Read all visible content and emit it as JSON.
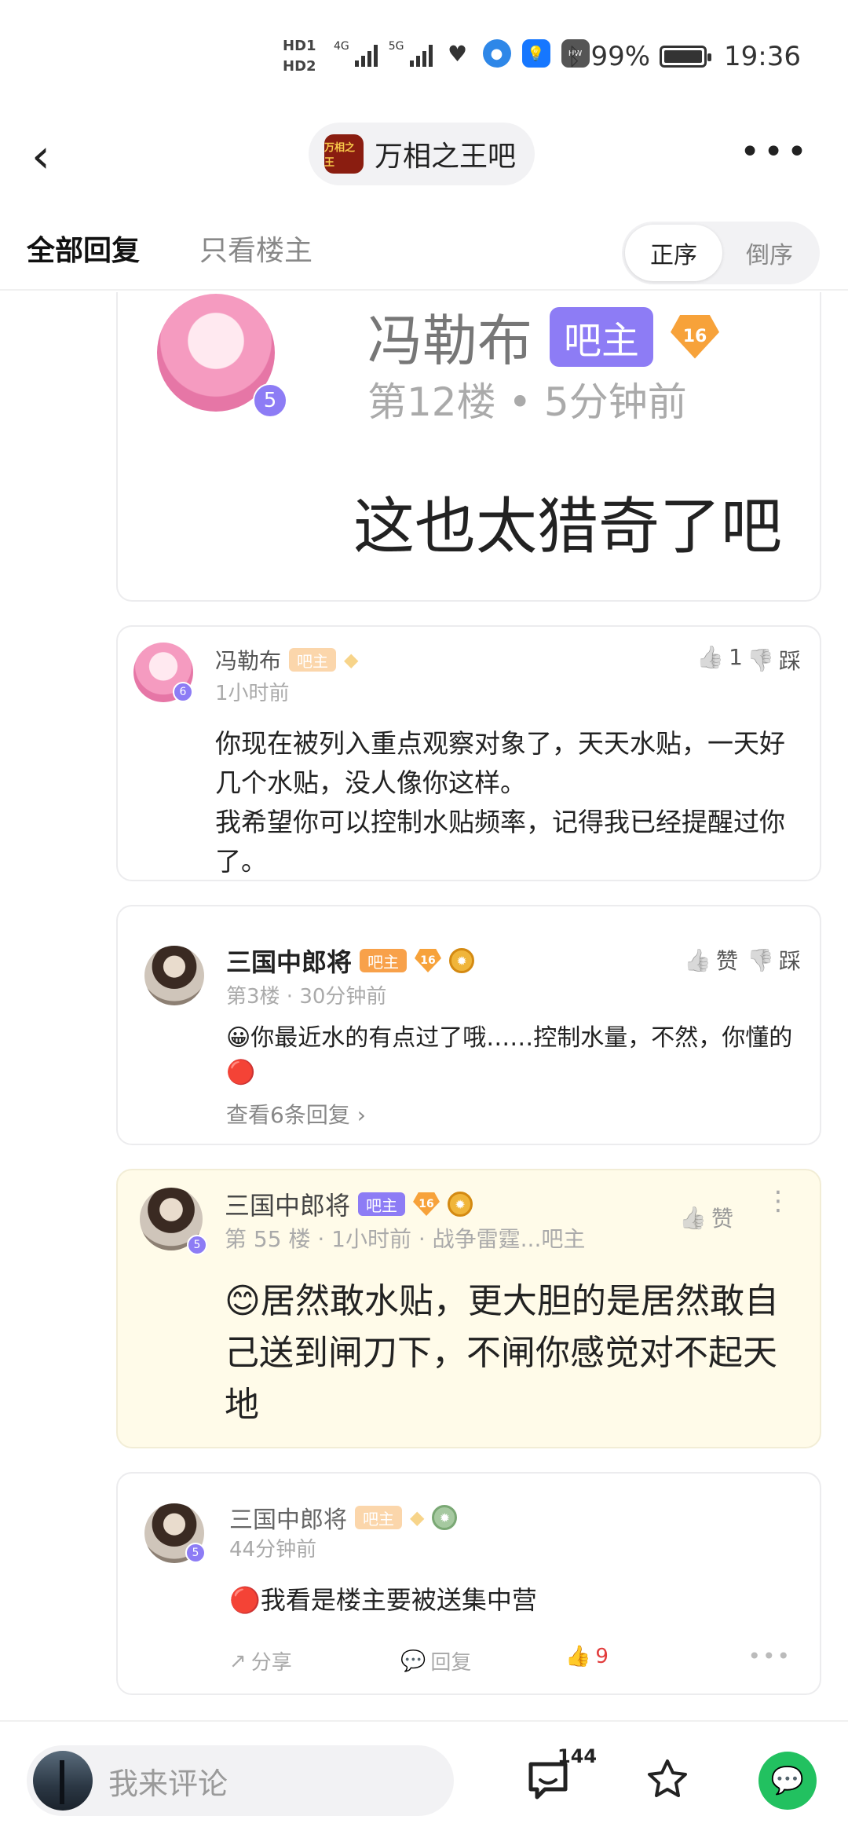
{
  "status_bar": {
    "hd1": "HD1",
    "hd2": "HD2",
    "net1": "4G",
    "net2": "5G",
    "battery_percent": "99%",
    "time": "19:36",
    "battery_level": 0.99
  },
  "header": {
    "forum_logo_text": "万相之王",
    "forum_name": "万相之王吧"
  },
  "tabs": {
    "all_replies": "全部回复",
    "owner_only": "只看楼主",
    "sort_asc": "正序",
    "sort_desc": "倒序"
  },
  "quoted_post": {
    "username": "冯勒布",
    "role_badge": "吧主",
    "level": "16",
    "avatar_level": "5",
    "meta": "第12楼 • 5分钟前",
    "content": "这也太猎奇了吧"
  },
  "reply1": {
    "username": "冯勒布",
    "role_badge": "吧主",
    "avatar_level": "6",
    "time": "1小时前",
    "like_count": "1",
    "dislike_label": "踩",
    "content": "你现在被列入重点观察对象了，天天水贴，一天好几个水贴，没人像你这样。\n我希望你可以控制水贴频率，记得我已经提醒过你了。"
  },
  "reply2": {
    "username": "三国中郎将",
    "role_badge": "吧主",
    "level": "16",
    "meta": "第3楼 · 30分钟前",
    "like_label": "赞",
    "dislike_label": "踩",
    "content": "你最近水的有点过了哦……控制水量，不然，你懂的",
    "view_replies": "查看6条回复"
  },
  "reply3": {
    "username": "三国中郎将",
    "role_badge": "吧主",
    "level": "16",
    "avatar_level": "5",
    "meta": "第 55 楼 · 1小时前 · 战争雷霆...吧主",
    "like_label": "赞",
    "content": "居然敢水贴，更大胆的是居然敢自己送到闸刀下，不闸你感觉对不起天地"
  },
  "reply4": {
    "username": "三国中郎将",
    "role_badge": "吧主",
    "avatar_level": "5",
    "time": "44分钟前",
    "content": "我看是楼主要被送集中营",
    "share_label": "分享",
    "reply_label": "回复",
    "like_count": "9"
  },
  "bottom_bar": {
    "comment_placeholder": "我来评论",
    "reply_count": "144"
  },
  "colors": {
    "badge_purple": "#8d7cf5",
    "badge_orange": "#f8a14a",
    "highlight_bg": "#fffbe9",
    "wechat_green": "#22c160"
  }
}
